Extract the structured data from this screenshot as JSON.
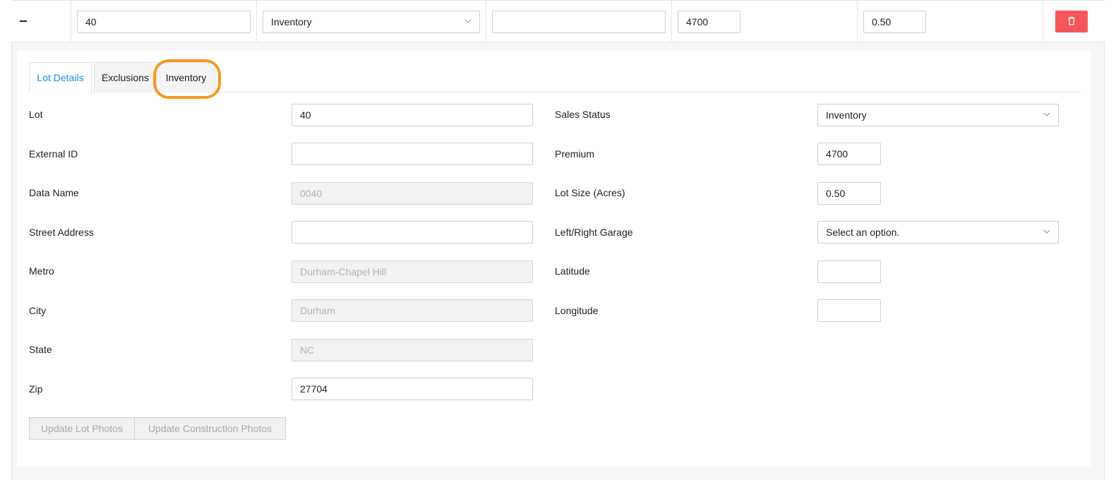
{
  "row": {
    "lot_value": "40",
    "sales_status_value": "Inventory",
    "external_id_value": "",
    "premium_value": "4700",
    "lot_size_value": "0.50"
  },
  "tabs": [
    {
      "label": "Lot Details"
    },
    {
      "label": "Exclusions"
    },
    {
      "label": "Inventory"
    }
  ],
  "form": {
    "left": [
      {
        "label": "Lot",
        "value": "40"
      },
      {
        "label": "External ID",
        "value": ""
      },
      {
        "label": "Data Name",
        "value": "0040"
      },
      {
        "label": "Street Address",
        "value": ""
      },
      {
        "label": "Metro",
        "value": "Durham-Chapel Hill"
      },
      {
        "label": "City",
        "value": "Durham"
      },
      {
        "label": "State",
        "value": "NC"
      },
      {
        "label": "Zip",
        "value": "27704"
      }
    ],
    "right": [
      {
        "label": "Sales Status",
        "value": "Inventory"
      },
      {
        "label": "Premium",
        "value": "4700"
      },
      {
        "label": "Lot Size (Acres)",
        "value": "0.50"
      },
      {
        "label": "Left/Right Garage",
        "value": "Select an option."
      },
      {
        "label": "Latitude",
        "value": ""
      },
      {
        "label": "Longitude",
        "value": ""
      }
    ]
  },
  "buttons": {
    "update_lot_photos": "Update Lot Photos",
    "update_construction_photos": "Update Construction Photos"
  },
  "icons": {
    "collapse": "minus-icon",
    "delete": "trash-icon",
    "select_arrow": "chevron-down-icon"
  },
  "colors": {
    "accent": "#1890e0",
    "danger": "#f5565b",
    "highlight": "#f59a23"
  }
}
